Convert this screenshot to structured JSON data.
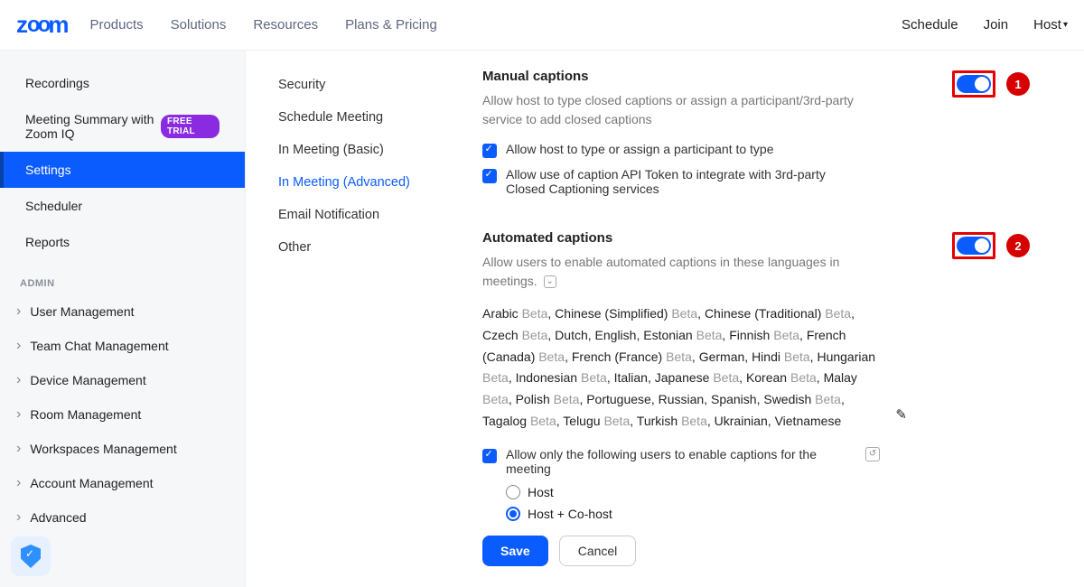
{
  "header": {
    "logo": "zoom",
    "nav_left": [
      "Products",
      "Solutions",
      "Resources",
      "Plans & Pricing"
    ],
    "nav_right": {
      "schedule": "Schedule",
      "join": "Join",
      "host": "Host"
    }
  },
  "sidebar1": {
    "recordings": "Recordings",
    "meeting_summary": "Meeting Summary with Zoom IQ",
    "free_trial": "FREE TRIAL",
    "settings": "Settings",
    "scheduler": "Scheduler",
    "reports": "Reports",
    "admin_label": "ADMIN",
    "admin_items": [
      "User Management",
      "Team Chat Management",
      "Device Management",
      "Room Management",
      "Workspaces Management",
      "Account Management",
      "Advanced"
    ]
  },
  "sidebar2": {
    "tabs": [
      "Security",
      "Schedule Meeting",
      "In Meeting (Basic)",
      "In Meeting (Advanced)",
      "Email Notification",
      "Other"
    ],
    "active_index": 3
  },
  "main": {
    "manual": {
      "title": "Manual captions",
      "desc": "Allow host to type closed captions or assign a participant/3rd-party service to add closed captions",
      "opt1": "Allow host to type or assign a participant to type",
      "opt2": "Allow use of caption API Token to integrate with 3rd-party Closed Captioning services",
      "toggle_on": true,
      "badge": "1"
    },
    "auto": {
      "title": "Automated captions",
      "desc": "Allow users to enable automated captions in these languages in meetings.",
      "toggle_on": true,
      "badge": "2",
      "languages": [
        {
          "name": "Arabic",
          "beta": true
        },
        {
          "name": "Chinese (Simplified)",
          "beta": true
        },
        {
          "name": "Chinese (Traditional)",
          "beta": true
        },
        {
          "name": "Czech",
          "beta": true
        },
        {
          "name": "Dutch",
          "beta": false
        },
        {
          "name": "English",
          "beta": false
        },
        {
          "name": "Estonian",
          "beta": true
        },
        {
          "name": "Finnish",
          "beta": true
        },
        {
          "name": "French (Canada)",
          "beta": true
        },
        {
          "name": "French (France)",
          "beta": true
        },
        {
          "name": "German",
          "beta": false
        },
        {
          "name": "Hindi",
          "beta": true
        },
        {
          "name": "Hungarian",
          "beta": true
        },
        {
          "name": "Indonesian",
          "beta": true
        },
        {
          "name": "Italian",
          "beta": false
        },
        {
          "name": "Japanese",
          "beta": true
        },
        {
          "name": "Korean",
          "beta": true
        },
        {
          "name": "Malay",
          "beta": true
        },
        {
          "name": "Polish",
          "beta": true
        },
        {
          "name": "Portuguese",
          "beta": false
        },
        {
          "name": "Russian",
          "beta": false
        },
        {
          "name": "Spanish",
          "beta": false
        },
        {
          "name": "Swedish",
          "beta": true
        },
        {
          "name": "Tagalog",
          "beta": true
        },
        {
          "name": "Telugu",
          "beta": true
        },
        {
          "name": "Turkish",
          "beta": true
        },
        {
          "name": "Ukrainian",
          "beta": false
        },
        {
          "name": "Vietnamese",
          "beta": false
        }
      ],
      "opt_restrict": "Allow only the following users to enable captions for the meeting",
      "radio_host": "Host",
      "radio_hostco": "Host + Co-host",
      "radio_selected": "hostco",
      "save": "Save",
      "cancel": "Cancel"
    }
  }
}
